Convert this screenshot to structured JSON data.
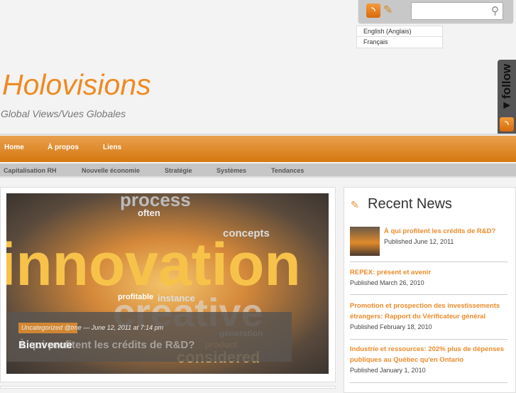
{
  "header": {
    "title": "Holovisions",
    "tagline": "Global Views/Vues Globales",
    "search_placeholder": "",
    "search_icon": "magnifier-icon",
    "rss_icon": "rss-icon",
    "mail_icon": "mail-pencil-icon"
  },
  "languages": [
    "English (Anglais)",
    "Français"
  ],
  "follow": {
    "label": "◂follow"
  },
  "nav": {
    "items": [
      "Home",
      "À propos",
      "Liens"
    ]
  },
  "subnav": {
    "items": [
      "Capitalisation RH",
      "Nouvelle économie",
      "Stratégie",
      "Systèmes",
      "Tendances"
    ]
  },
  "slider": {
    "category": "Uncategorized",
    "meta": "@tme — June 12, 2011 at 7:14 pm",
    "title": "Bienvenue",
    "title_fading": "À qui profitent les crédits de R&D?",
    "image_words": [
      "innovation",
      "creative",
      "process",
      "concepts",
      "considered",
      "often",
      "profitable",
      "instance",
      "generation",
      "product"
    ]
  },
  "sidebar": {
    "heading": "Recent News",
    "items": [
      {
        "title": "À qui profitent les crédits de R&D?",
        "date": "Published June 12, 2011"
      },
      {
        "title": "REPEX: présent et avenir",
        "date": "Published March 26, 2010"
      },
      {
        "title": "Promotion et prospection des investissements étrangers: Rapport du Vérificateur général",
        "date": "Published February 18, 2010"
      },
      {
        "title": "Industrie et ressources: 202% plus de dépenses publiques au Québec qu'en Ontario",
        "date": "Published January 1, 2010"
      }
    ]
  }
}
